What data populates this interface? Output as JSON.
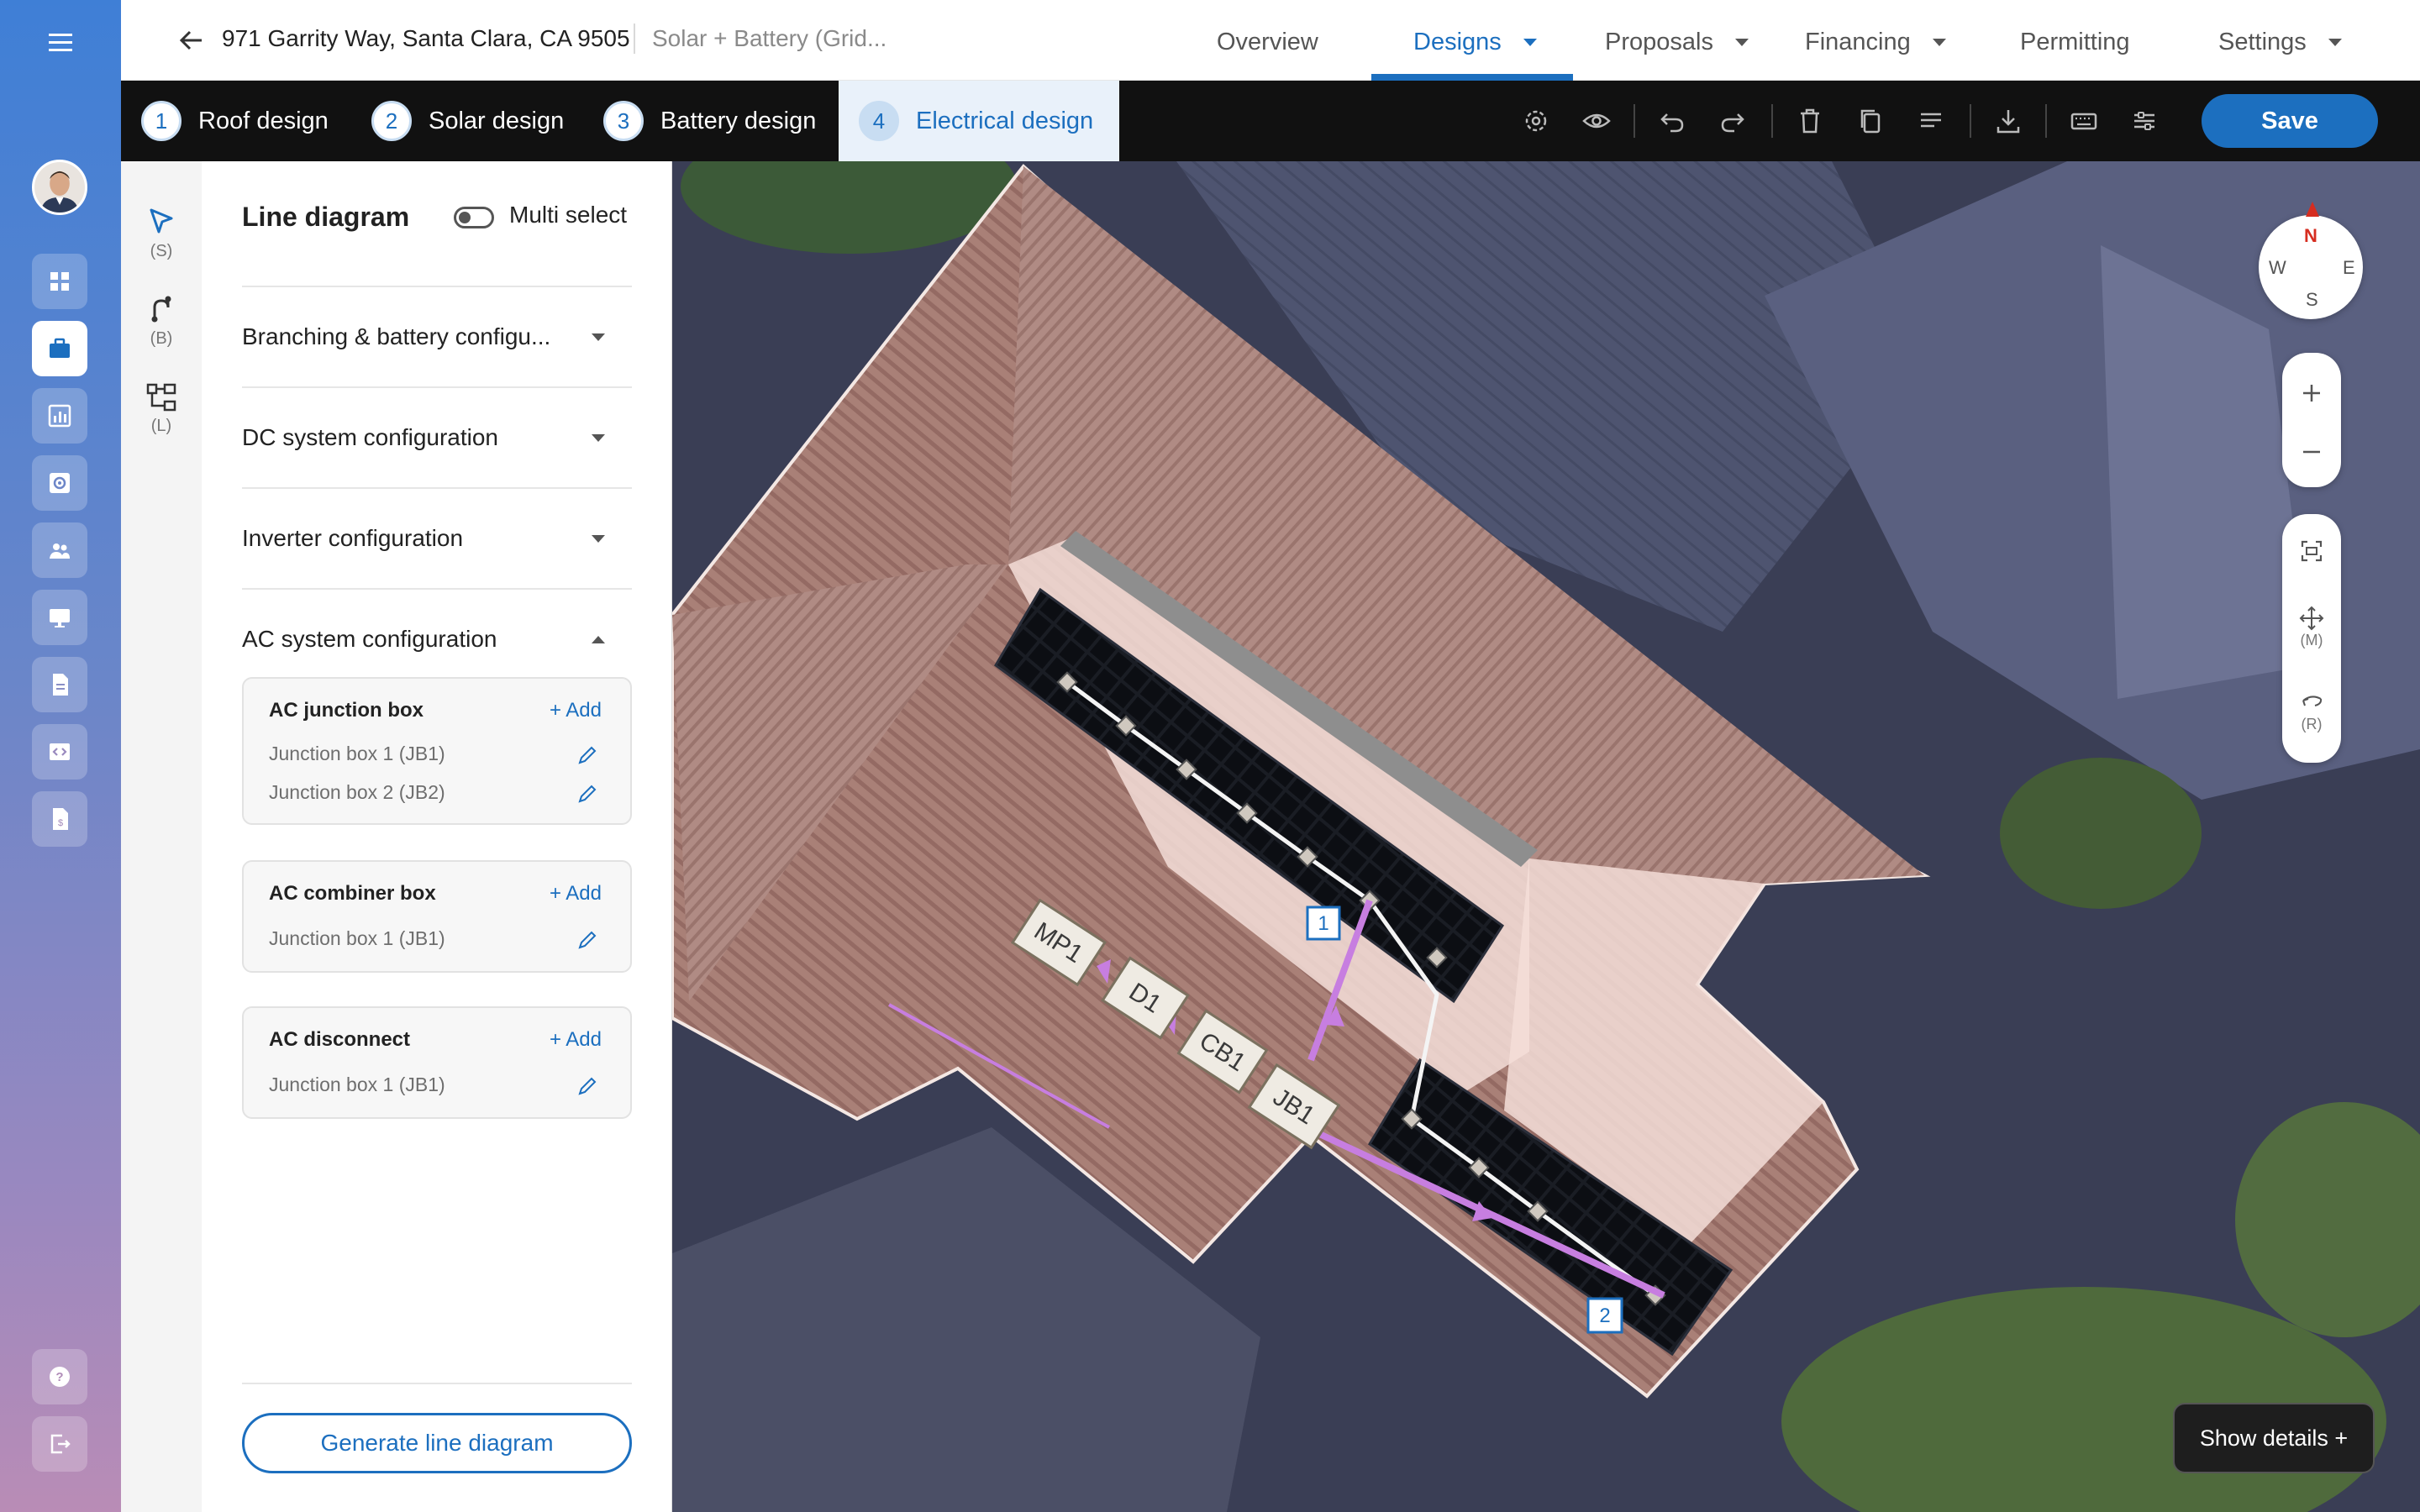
{
  "app": {
    "address": "971 Garrity Way, Santa Clara, CA 9505",
    "project_type": "Solar + Battery (Grid...",
    "colors": {
      "accent": "#1c6fbf",
      "connector": "#c77ee0"
    }
  },
  "nav_tabs": [
    {
      "label": "Overview",
      "active": false,
      "has_menu": false
    },
    {
      "label": "Designs",
      "active": true,
      "has_menu": true
    },
    {
      "label": "Proposals",
      "active": false,
      "has_menu": true
    },
    {
      "label": "Financing",
      "active": false,
      "has_menu": true
    },
    {
      "label": "Permitting",
      "active": false,
      "has_menu": false
    },
    {
      "label": "Settings",
      "active": false,
      "has_menu": true
    }
  ],
  "steps": [
    {
      "num": "1",
      "label": "Roof design"
    },
    {
      "num": "2",
      "label": "Solar design"
    },
    {
      "num": "3",
      "label": "Battery design"
    },
    {
      "num": "4",
      "label": "Electrical design",
      "active": true
    }
  ],
  "toolbar": {
    "icons": [
      "settings-icon",
      "eye-icon",
      "undo-icon",
      "redo-icon",
      "trash-icon",
      "copy-icon",
      "align-icon",
      "download-icon",
      "keyboard-icon",
      "sliders-icon"
    ],
    "save_label": "Save"
  },
  "tools": [
    {
      "icon": "cursor-icon",
      "key": "(S)"
    },
    {
      "icon": "wire-icon",
      "key": "(B)"
    },
    {
      "icon": "line-diagram-icon",
      "key": "(L)"
    }
  ],
  "panel": {
    "title": "Line diagram",
    "multi_select_label": "Multi select",
    "multi_select_on": false,
    "sections": [
      {
        "label": "Branching & battery configu...",
        "expanded": false
      },
      {
        "label": "DC system configuration",
        "expanded": false
      },
      {
        "label": "Inverter configuration",
        "expanded": false
      },
      {
        "label": "AC system configuration",
        "expanded": true
      }
    ],
    "cards": [
      {
        "title": "AC junction box",
        "add_label": "+ Add",
        "items": [
          "Junction box 1 (JB1)",
          "Junction box 2 (JB2)"
        ]
      },
      {
        "title": "AC combiner box",
        "add_label": "+ Add",
        "items": [
          "Junction box 1 (JB1)"
        ]
      },
      {
        "title": "AC disconnect",
        "add_label": "+ Add",
        "items": [
          "Junction box 1 (JB1)"
        ]
      }
    ],
    "generate_label": "Generate line diagram"
  },
  "map": {
    "equipment_labels": [
      "MP1",
      "D1",
      "CB1",
      "JB1"
    ],
    "string_labels": [
      "1",
      "2"
    ],
    "compass": {
      "n": "N",
      "s": "S",
      "w": "W",
      "e": "E"
    },
    "control_keys": [
      "(M)",
      "(R)"
    ],
    "show_details_label": "Show details +"
  }
}
